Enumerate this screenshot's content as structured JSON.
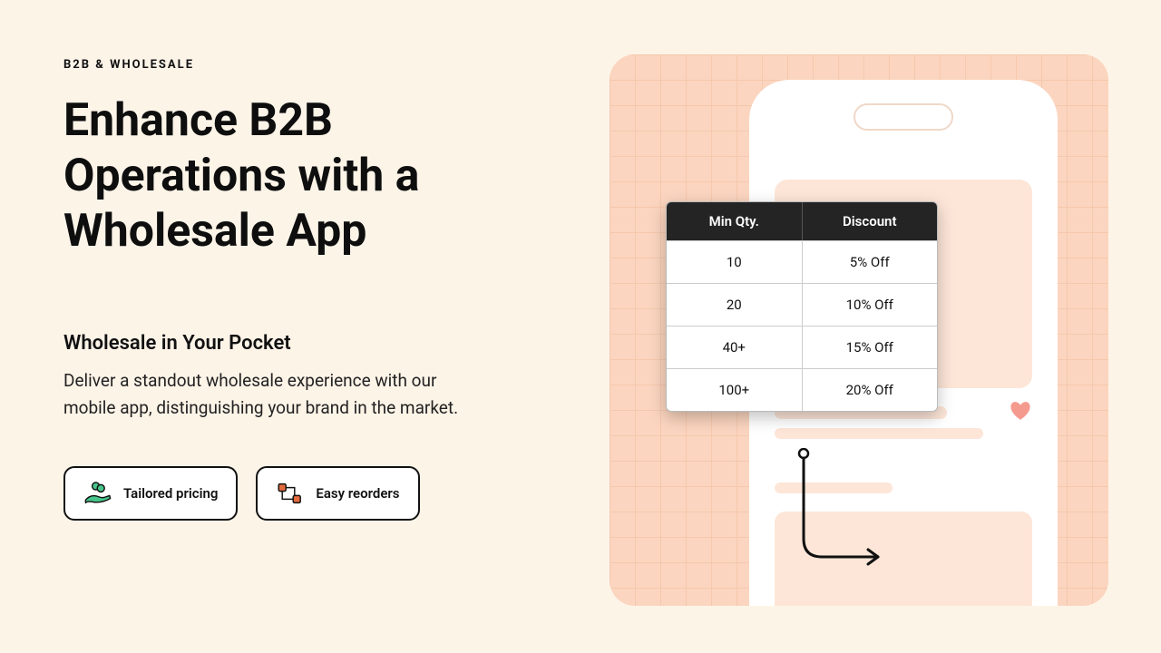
{
  "eyebrow": "B2B & WHOLESALE",
  "headline": "Enhance B2B Operations with a Wholesale App",
  "subhead": "Wholesale in Your Pocket",
  "body": "Deliver a standout wholesale experience with our mobile app, distinguishing your brand in the market.",
  "pills": {
    "tailored": "Tailored pricing",
    "reorders": "Easy reorders"
  },
  "table": {
    "headers": {
      "qty": "Min Qty.",
      "discount": "Discount"
    },
    "rows": [
      {
        "qty": "10",
        "discount": "5% Off"
      },
      {
        "qty": "20",
        "discount": "10% Off"
      },
      {
        "qty": "40+",
        "discount": "15% Off"
      },
      {
        "qty": "100+",
        "discount": "20% Off"
      }
    ]
  },
  "colors": {
    "page_bg": "#fdf4e8",
    "panel_bg": "#fbd5bf",
    "phone_block": "#fde6d8",
    "table_header": "#242424",
    "accent_green": "#46c58b",
    "accent_orange": "#e36a3d",
    "heart": "#f59a8f"
  }
}
